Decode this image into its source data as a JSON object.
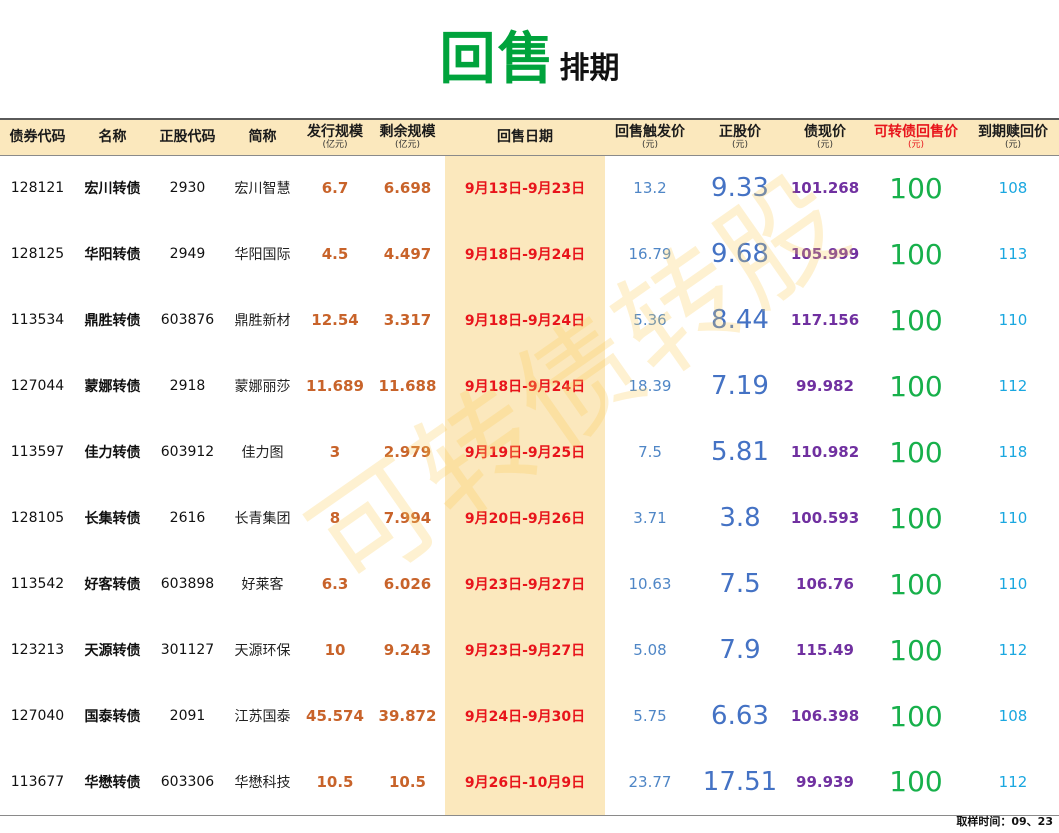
{
  "title": {
    "main": "回售",
    "sub": "排期"
  },
  "watermark": "可转债转股",
  "headers": [
    {
      "label": "债券代码",
      "unit": ""
    },
    {
      "label": "名称",
      "unit": ""
    },
    {
      "label": "正股代码",
      "unit": ""
    },
    {
      "label": "简称",
      "unit": ""
    },
    {
      "label": "发行规模",
      "unit": "(亿元)"
    },
    {
      "label": "剩余规模",
      "unit": "(亿元)"
    },
    {
      "label": "回售日期",
      "unit": ""
    },
    {
      "label": "回售触发价",
      "unit": "(元)"
    },
    {
      "label": "正股价",
      "unit": "(元)"
    },
    {
      "label": "债现价",
      "unit": "(元)"
    },
    {
      "label": "可转债回售价",
      "unit": "(元)"
    },
    {
      "label": "到期赎回价",
      "unit": "(元)"
    }
  ],
  "rows": [
    {
      "code": "128121",
      "name": "宏川转债",
      "stock_code": "2930",
      "short": "宏川智慧",
      "issue": "6.7",
      "remain": "6.698",
      "date": "9月13日-9月23日",
      "trigger": "13.2",
      "price": "9.33",
      "bond": "101.268",
      "putback": "100",
      "maturity": "108"
    },
    {
      "code": "128125",
      "name": "华阳转债",
      "stock_code": "2949",
      "short": "华阳国际",
      "issue": "4.5",
      "remain": "4.497",
      "date": "9月18日-9月24日",
      "trigger": "16.79",
      "price": "9.68",
      "bond": "105.999",
      "putback": "100",
      "maturity": "113"
    },
    {
      "code": "113534",
      "name": "鼎胜转债",
      "stock_code": "603876",
      "short": "鼎胜新材",
      "issue": "12.54",
      "remain": "3.317",
      "date": "9月18日-9月24日",
      "trigger": "5.36",
      "price": "8.44",
      "bond": "117.156",
      "putback": "100",
      "maturity": "110"
    },
    {
      "code": "127044",
      "name": "蒙娜转债",
      "stock_code": "2918",
      "short": "蒙娜丽莎",
      "issue": "11.689",
      "remain": "11.688",
      "date": "9月18日-9月24日",
      "trigger": "18.39",
      "price": "7.19",
      "bond": "99.982",
      "putback": "100",
      "maturity": "112"
    },
    {
      "code": "113597",
      "name": "佳力转债",
      "stock_code": "603912",
      "short": "佳力图",
      "issue": "3",
      "remain": "2.979",
      "date": "9月19日-9月25日",
      "trigger": "7.5",
      "price": "5.81",
      "bond": "110.982",
      "putback": "100",
      "maturity": "118"
    },
    {
      "code": "128105",
      "name": "长集转债",
      "stock_code": "2616",
      "short": "长青集团",
      "issue": "8",
      "remain": "7.994",
      "date": "9月20日-9月26日",
      "trigger": "3.71",
      "price": "3.8",
      "bond": "100.593",
      "putback": "100",
      "maturity": "110"
    },
    {
      "code": "113542",
      "name": "好客转债",
      "stock_code": "603898",
      "short": "好莱客",
      "issue": "6.3",
      "remain": "6.026",
      "date": "9月23日-9月27日",
      "trigger": "10.63",
      "price": "7.5",
      "bond": "106.76",
      "putback": "100",
      "maturity": "110"
    },
    {
      "code": "123213",
      "name": "天源转债",
      "stock_code": "301127",
      "short": "天源环保",
      "issue": "10",
      "remain": "9.243",
      "date": "9月23日-9月27日",
      "trigger": "5.08",
      "price": "7.9",
      "bond": "115.49",
      "putback": "100",
      "maturity": "112"
    },
    {
      "code": "127040",
      "name": "国泰转债",
      "stock_code": "2091",
      "short": "江苏国泰",
      "issue": "45.574",
      "remain": "39.872",
      "date": "9月24日-9月30日",
      "trigger": "5.75",
      "price": "6.63",
      "bond": "106.398",
      "putback": "100",
      "maturity": "108"
    },
    {
      "code": "113677",
      "name": "华懋转债",
      "stock_code": "603306",
      "short": "华懋科技",
      "issue": "10.5",
      "remain": "10.5",
      "date": "9月26日-10月9日",
      "trigger": "23.77",
      "price": "17.51",
      "bond": "99.939",
      "putback": "100",
      "maturity": "112"
    }
  ],
  "footer": "取样时间：09、23"
}
